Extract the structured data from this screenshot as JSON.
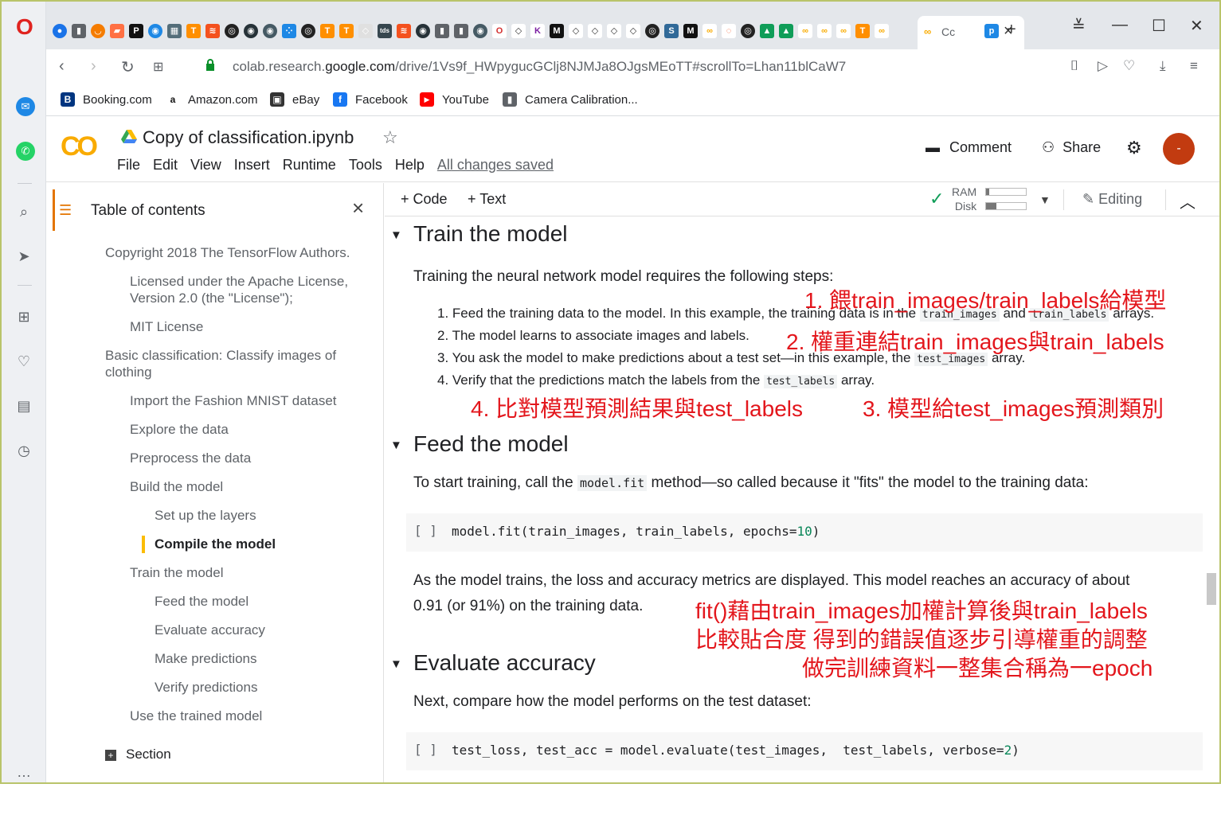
{
  "browser": {
    "url_prefix": "colab.research.",
    "url_domain": "google.com",
    "url_path": "/drive/1Vs9f_HWpygucGClj8NJMJa8OJgsMEoTT#scrollTo=Lhan11blCaW7",
    "active_tab_label": "Cc",
    "bookmarks": [
      "Booking.com",
      "Amazon.com",
      "eBay",
      "Facebook",
      "YouTube",
      "Camera Calibration..."
    ]
  },
  "colab": {
    "logo": "CO",
    "title": "Copy of classification.ipynb",
    "menu": [
      "File",
      "Edit",
      "View",
      "Insert",
      "Runtime",
      "Tools",
      "Help"
    ],
    "saved_status": "All changes saved",
    "comment_label": "Comment",
    "share_label": "Share",
    "avatar_label": "-",
    "add_code": "+ Code",
    "add_text": "+ Text",
    "ram_label": "RAM",
    "disk_label": "Disk",
    "ram_usage": 0.07,
    "disk_usage": 0.25,
    "editing_label": "Editing"
  },
  "toc": {
    "title": "Table of contents",
    "items": [
      "Copyright 2018 The TensorFlow Authors.",
      "Licensed under the Apache License,",
      "Version 2.0 (the \"License\");",
      "MIT License",
      "Basic classification: Classify images of",
      "clothing",
      "Import the Fashion MNIST dataset",
      "Explore the data",
      "Preprocess the data",
      "Build the model",
      "Set up the layers",
      "Compile the model",
      "Train the model",
      "Feed the model",
      "Evaluate accuracy",
      "Make predictions",
      "Verify predictions",
      "Use the trained model"
    ],
    "add_section": "Section"
  },
  "notebook": {
    "sec1_title": "Train the model",
    "sec1_intro": "Training the neural network model requires the following steps:",
    "step1_a": "1. Feed the training data to the model. In this example, the training data is in the",
    "step1_code1": "train_images",
    "step1_b": "and",
    "step1_code2": "train_labels",
    "step1_c": "arrays.",
    "step2": "2. The model learns to associate images and labels.",
    "step3_a": "3. You ask the model to make predictions about a test set—in this example, the",
    "step3_code": "test_images",
    "step3_b": "array.",
    "step4_a": "4. Verify that the predictions match the labels from the",
    "step4_code": "test_labels",
    "step4_b": "array.",
    "sec2_title": "Feed the model",
    "sec2_text_a": "To start training, call the",
    "sec2_code": "model.fit",
    "sec2_text_b": "method—so called because it \"fits\" the model to the training data:",
    "cell1_bracket": "[ ]",
    "cell1_src": "model.fit(train_images, train_labels, epochs=",
    "cell1_num": "10",
    "cell1_end": ")",
    "after_cell1_l1": "As the model trains, the loss and accuracy metrics are displayed. This model reaches an accuracy of about",
    "after_cell1_l2": "0.91 (or 91%) on the training data.",
    "sec3_title": "Evaluate accuracy",
    "sec3_text": "Next, compare how the model performs on the test dataset:",
    "cell2_bracket": "[ ]",
    "cell2_src": "test_loss, test_acc = model.evaluate(test_images,  test_labels, verbose=",
    "cell2_num": "2",
    "cell2_end": ")"
  },
  "annotations": {
    "a1": "1. 餵train_images/train_labels給模型",
    "a2": "2. 權重連結train_images與train_labels",
    "a4": "4. 比對模型預測結果與test_labels",
    "a3": "3. 模型給test_images預測類別",
    "fit1": "fit()藉由train_images加權計算後與train_labels",
    "fit2": "比較貼合度 得到的錯誤值逐步引導權重的調整",
    "fit3": "做完訓練資料一整集合稱為一epoch"
  },
  "colors": {
    "annotation": "#e3161c",
    "colab_orange": "#f9ab00",
    "accent": "#e37400",
    "avatar": "#c23b10"
  }
}
